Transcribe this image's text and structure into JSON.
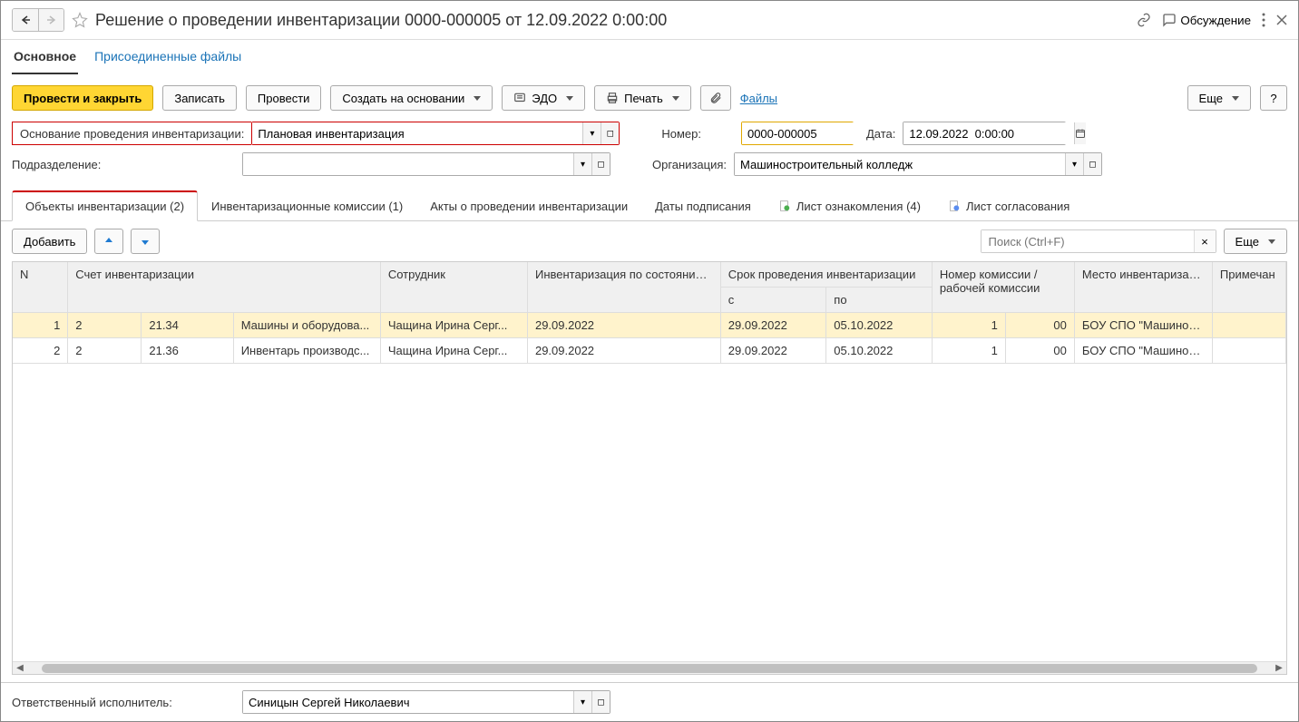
{
  "title": "Решение о проведении инвентаризации 0000-000005 от 12.09.2022 0:00:00",
  "header": {
    "discuss": "Обсуждение"
  },
  "sections": {
    "main": "Основное",
    "attached": "Присоединенные файлы"
  },
  "toolbar": {
    "post_close": "Провести и закрыть",
    "save": "Записать",
    "post": "Провести",
    "create_based": "Создать на основании",
    "edo": "ЭДО",
    "print": "Печать",
    "files": "Файлы",
    "more": "Еще",
    "help": "?"
  },
  "form": {
    "basis_label": "Основание проведения инвентаризации:",
    "basis_value": "Плановая инвентаризация",
    "number_label": "Номер:",
    "number_value": "0000-000005",
    "date_label": "Дата:",
    "date_value": "12.09.2022  0:00:00",
    "division_label": "Подразделение:",
    "division_value": "",
    "org_label": "Организация:",
    "org_value": "Машиностроительный колледж"
  },
  "tabs": {
    "objects": "Объекты инвентаризации (2)",
    "commissions": "Инвентаризационные комиссии (1)",
    "acts": "Акты о проведении инвентаризации",
    "sign_dates": "Даты подписания",
    "ack_sheet": "Лист ознакомления (4)",
    "approval_sheet": "Лист согласования"
  },
  "subtoolbar": {
    "add": "Добавить",
    "search_placeholder": "Поиск (Ctrl+F)",
    "more": "Еще"
  },
  "columns": {
    "n": "N",
    "account": "Счет инвентаризации",
    "employee": "Сотрудник",
    "inv_asof": "Инвентаризация по состоянию на",
    "period": "Срок проведения инвентаризации",
    "from": "с",
    "to": "по",
    "commission_no": "Номер комиссии / рабочей комиссии",
    "place": "Место инвентаризации",
    "note": "Примечан"
  },
  "rows": [
    {
      "n": "1",
      "acc1": "2",
      "acc2": "21.34",
      "acc3": "Машины и оборудова...",
      "emp": "Чащина Ирина Серг...",
      "asof": "29.09.2022",
      "from": "29.09.2022",
      "to": "05.10.2022",
      "comm_a": "1",
      "comm_b": "00",
      "place": "БОУ СПО \"Машиност..."
    },
    {
      "n": "2",
      "acc1": "2",
      "acc2": "21.36",
      "acc3": "Инвентарь производс...",
      "emp": "Чащина Ирина Серг...",
      "asof": "29.09.2022",
      "from": "29.09.2022",
      "to": "05.10.2022",
      "comm_a": "1",
      "comm_b": "00",
      "place": "БОУ СПО \"Машиност..."
    }
  ],
  "footer": {
    "responsible_label": "Ответственный исполнитель:",
    "responsible_value": "Синицын Сергей Николаевич"
  }
}
